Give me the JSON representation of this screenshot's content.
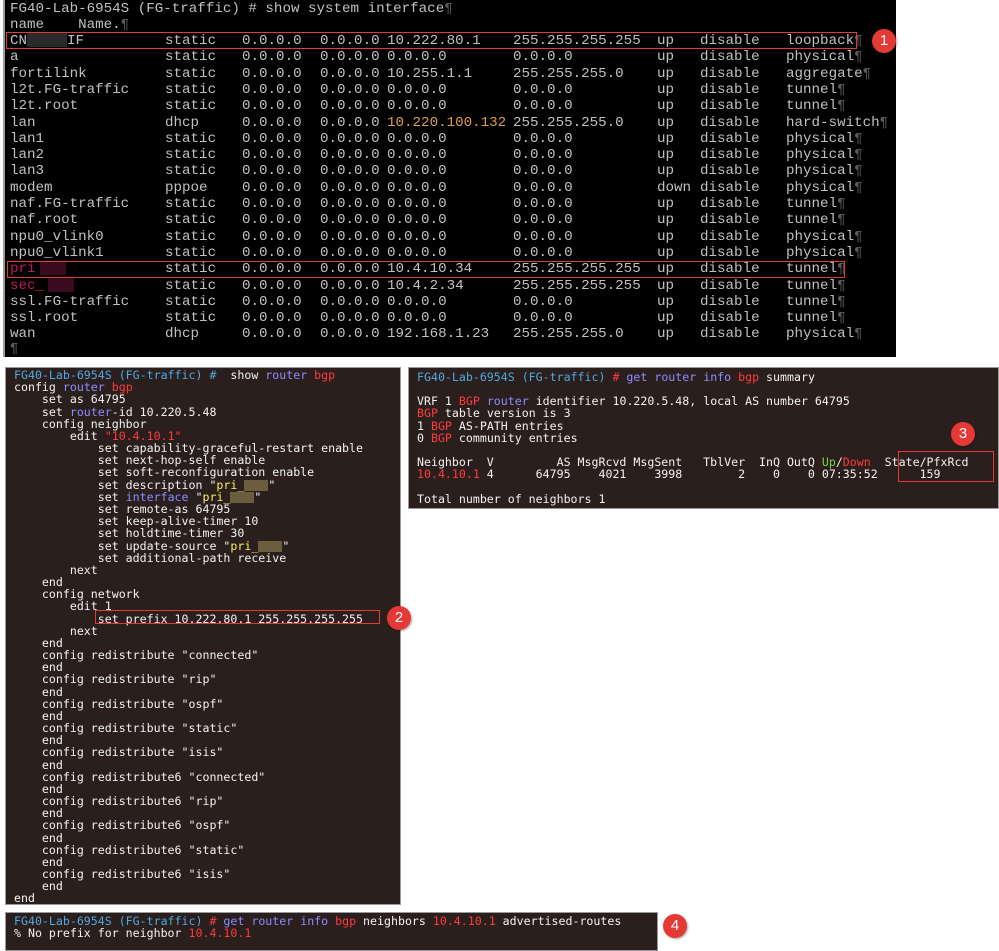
{
  "interfaces_panel": {
    "prompt": "FG40-Lab-6954S (FG-traffic) # show system interface",
    "header": "name    Name.",
    "rows": [
      {
        "name": "CN",
        "name_suffix": "IF",
        "mode": "static",
        "a1": "0.0.0.0",
        "a2": "0.0.0.0",
        "ip": "10.222.80.1",
        "mask": "255.255.255.255",
        "status": "up",
        "s2": "disable",
        "type": "loopback",
        "highlight": true
      },
      {
        "name": "a",
        "mode": "static",
        "a1": "0.0.0.0",
        "a2": "0.0.0.0",
        "ip": "0.0.0.0",
        "mask": "0.0.0.0",
        "status": "up",
        "s2": "disable",
        "type": "physical"
      },
      {
        "name": "fortilink",
        "mode": "static",
        "a1": "0.0.0.0",
        "a2": "0.0.0.0",
        "ip": "10.255.1.1",
        "mask": "255.255.255.0",
        "status": "up",
        "s2": "disable",
        "type": "aggregate"
      },
      {
        "name": "l2t.FG-traffic",
        "mode": "static",
        "a1": "0.0.0.0",
        "a2": "0.0.0.0",
        "ip": "0.0.0.0",
        "mask": "0.0.0.0",
        "status": "up",
        "s2": "disable",
        "type": "tunnel"
      },
      {
        "name": "l2t.root",
        "mode": "static",
        "a1": "0.0.0.0",
        "a2": "0.0.0.0",
        "ip": "0.0.0.0",
        "mask": "0.0.0.0",
        "status": "up",
        "s2": "disable",
        "type": "tunnel"
      },
      {
        "name": "lan",
        "mode": "dhcp",
        "a1": "0.0.0.0",
        "a2": "0.0.0.0",
        "ip": "10.220.100.132",
        "ip_color": "orange",
        "mask": "255.255.255.0",
        "status": "up",
        "s2": "disable",
        "type": "hard-switch"
      },
      {
        "name": "lan1",
        "mode": "static",
        "a1": "0.0.0.0",
        "a2": "0.0.0.0",
        "ip": "0.0.0.0",
        "mask": "0.0.0.0",
        "status": "up",
        "s2": "disable",
        "type": "physical"
      },
      {
        "name": "lan2",
        "mode": "static",
        "a1": "0.0.0.0",
        "a2": "0.0.0.0",
        "ip": "0.0.0.0",
        "mask": "0.0.0.0",
        "status": "up",
        "s2": "disable",
        "type": "physical"
      },
      {
        "name": "lan3",
        "mode": "static",
        "a1": "0.0.0.0",
        "a2": "0.0.0.0",
        "ip": "0.0.0.0",
        "mask": "0.0.0.0",
        "status": "up",
        "s2": "disable",
        "type": "physical"
      },
      {
        "name": "modem",
        "mode": "pppoe",
        "a1": "0.0.0.0",
        "a2": "0.0.0.0",
        "ip": "0.0.0.0",
        "mask": "0.0.0.0",
        "status": "down",
        "s2": "disable",
        "type": "physical"
      },
      {
        "name": "naf.FG-traffic",
        "mode": "static",
        "a1": "0.0.0.0",
        "a2": "0.0.0.0",
        "ip": "0.0.0.0",
        "mask": "0.0.0.0",
        "status": "up",
        "s2": "disable",
        "type": "tunnel"
      },
      {
        "name": "naf.root",
        "mode": "static",
        "a1": "0.0.0.0",
        "a2": "0.0.0.0",
        "ip": "0.0.0.0",
        "mask": "0.0.0.0",
        "status": "up",
        "s2": "disable",
        "type": "tunnel"
      },
      {
        "name": "npu0_vlink0",
        "mode": "static",
        "a1": "0.0.0.0",
        "a2": "0.0.0.0",
        "ip": "0.0.0.0",
        "mask": "0.0.0.0",
        "status": "up",
        "s2": "disable",
        "type": "physical"
      },
      {
        "name": "npu0_vlink1",
        "mode": "static",
        "a1": "0.0.0.0",
        "a2": "0.0.0.0",
        "ip": "0.0.0.0",
        "mask": "0.0.0.0",
        "status": "up",
        "s2": "disable",
        "type": "physical"
      },
      {
        "name": "pri",
        "name_color": "magenta",
        "redacted": true,
        "mode": "static",
        "a1": "0.0.0.0",
        "a2": "0.0.0.0",
        "ip": "10.4.10.34",
        "mask": "255.255.255.255",
        "status": "up",
        "s2": "disable",
        "type": "tunnel",
        "highlight": true
      },
      {
        "name": "sec_",
        "name_color": "magenta",
        "redacted": true,
        "mode": "static",
        "a1": "0.0.0.0",
        "a2": "0.0.0.0",
        "ip": "10.4.2.34",
        "mask": "255.255.255.255",
        "status": "up",
        "s2": "disable",
        "type": "tunnel"
      },
      {
        "name": "ssl.FG-traffic",
        "mode": "static",
        "a1": "0.0.0.0",
        "a2": "0.0.0.0",
        "ip": "0.0.0.0",
        "mask": "0.0.0.0",
        "status": "up",
        "s2": "disable",
        "type": "tunnel"
      },
      {
        "name": "ssl.root",
        "mode": "static",
        "a1": "0.0.0.0",
        "a2": "0.0.0.0",
        "ip": "0.0.0.0",
        "mask": "0.0.0.0",
        "status": "up",
        "s2": "disable",
        "type": "tunnel"
      },
      {
        "name": "wan",
        "mode": "dhcp",
        "a1": "0.0.0.0",
        "a2": "0.0.0.0",
        "ip": "192.168.1.23",
        "mask": "255.255.255.0",
        "status": "up",
        "s2": "disable",
        "type": "physical"
      }
    ],
    "pilcrow": "¶",
    "badge": "1"
  },
  "bgp_config_panel": {
    "prompt_host": "FG40-Lab-6954S (FG-traffic) #",
    "prompt_cmd": [
      {
        "t": "  show ",
        "c": ""
      },
      {
        "t": "router",
        "c": "blue"
      },
      {
        "t": " ",
        "c": ""
      },
      {
        "t": "bgp",
        "c": "red"
      }
    ],
    "lines": [
      [
        {
          "t": "config ",
          "c": ""
        },
        {
          "t": "router",
          "c": "blue"
        },
        {
          "t": " ",
          "c": ""
        },
        {
          "t": "bgp",
          "c": "red"
        }
      ],
      [
        {
          "t": "    set as 64795",
          "c": ""
        }
      ],
      [
        {
          "t": "    set ",
          "c": ""
        },
        {
          "t": "router",
          "c": "blue"
        },
        {
          "t": "-id 10.220.5.48",
          "c": ""
        }
      ],
      [
        {
          "t": "    config neighbor",
          "c": ""
        }
      ],
      [
        {
          "t": "        edit ",
          "c": ""
        },
        {
          "t": "\"10.4.10.1\"",
          "c": "red"
        }
      ],
      [
        {
          "t": "            set capability-graceful-restart enable",
          "c": ""
        }
      ],
      [
        {
          "t": "            set next-hop-self enable",
          "c": ""
        }
      ],
      [
        {
          "t": "            set soft-reconfiguration enable",
          "c": ""
        }
      ],
      [
        {
          "t": "            set description \"",
          "c": ""
        },
        {
          "t": "pri_",
          "c": "yellow"
        },
        {
          "t": "#R",
          "c": ""
        },
        {
          "t": "\"",
          "c": ""
        }
      ],
      [
        {
          "t": "            set ",
          "c": ""
        },
        {
          "t": "interface",
          "c": "blue"
        },
        {
          "t": " \"",
          "c": ""
        },
        {
          "t": "pri_",
          "c": "yellow"
        },
        {
          "t": "#R",
          "c": ""
        },
        {
          "t": "\"",
          "c": ""
        }
      ],
      [
        {
          "t": "            set remote-as 64795",
          "c": ""
        }
      ],
      [
        {
          "t": "            set keep-alive-timer 10",
          "c": ""
        }
      ],
      [
        {
          "t": "            set holdtime-timer 30",
          "c": ""
        }
      ],
      [
        {
          "t": "            set update-source \"",
          "c": ""
        },
        {
          "t": "pri_",
          "c": "yellow"
        },
        {
          "t": "#R",
          "c": ""
        },
        {
          "t": "\"",
          "c": ""
        }
      ],
      [
        {
          "t": "            set additional-path receive",
          "c": ""
        }
      ],
      [
        {
          "t": "        next",
          "c": ""
        }
      ],
      [
        {
          "t": "    end",
          "c": ""
        }
      ],
      [
        {
          "t": "    config network",
          "c": ""
        }
      ],
      [
        {
          "t": "        edit 1",
          "c": ""
        }
      ],
      [
        {
          "t": "            set prefix 10.222.80.1 255.255.255.255",
          "c": ""
        }
      ],
      [
        {
          "t": "        next",
          "c": ""
        }
      ],
      [
        {
          "t": "    end",
          "c": ""
        }
      ],
      [
        {
          "t": "    config redistribute \"connected\"",
          "c": ""
        }
      ],
      [
        {
          "t": "    end",
          "c": ""
        }
      ],
      [
        {
          "t": "    config redistribute \"rip\"",
          "c": ""
        }
      ],
      [
        {
          "t": "    end",
          "c": ""
        }
      ],
      [
        {
          "t": "    config redistribute \"ospf\"",
          "c": ""
        }
      ],
      [
        {
          "t": "    end",
          "c": ""
        }
      ],
      [
        {
          "t": "    config redistribute \"static\"",
          "c": ""
        }
      ],
      [
        {
          "t": "    end",
          "c": ""
        }
      ],
      [
        {
          "t": "    config redistribute \"isis\"",
          "c": ""
        }
      ],
      [
        {
          "t": "    end",
          "c": ""
        }
      ],
      [
        {
          "t": "    config redistribute6 \"connected\"",
          "c": ""
        }
      ],
      [
        {
          "t": "    end",
          "c": ""
        }
      ],
      [
        {
          "t": "    config redistribute6 \"rip\"",
          "c": ""
        }
      ],
      [
        {
          "t": "    end",
          "c": ""
        }
      ],
      [
        {
          "t": "    config redistribute6 \"ospf\"",
          "c": ""
        }
      ],
      [
        {
          "t": "    end",
          "c": ""
        }
      ],
      [
        {
          "t": "    config redistribute6 \"static\"",
          "c": ""
        }
      ],
      [
        {
          "t": "    end",
          "c": ""
        }
      ],
      [
        {
          "t": "    config redistribute6 \"isis\"",
          "c": ""
        }
      ],
      [
        {
          "t": "    end",
          "c": ""
        }
      ],
      [
        {
          "t": "end",
          "c": ""
        }
      ]
    ],
    "highlight_line_index": 19,
    "badge": "2"
  },
  "bgp_summary_panel": {
    "prompt_host": "FG40-Lab-6954S (FG-traffic)",
    "prompt_hash": " #",
    "prompt_cmd": [
      {
        "t": " get ",
        "c": "blue"
      },
      {
        "t": "router",
        "c": "blue"
      },
      {
        "t": " info ",
        "c": "blue"
      },
      {
        "t": "bgp",
        "c": "red"
      },
      {
        "t": " summary",
        "c": ""
      }
    ],
    "lines": [
      [],
      [
        {
          "t": "VRF 1 ",
          "c": ""
        },
        {
          "t": "BGP",
          "c": "red"
        },
        {
          "t": " ",
          "c": ""
        },
        {
          "t": "router",
          "c": "blue"
        },
        {
          "t": " identifier 10.220.5.48, local AS number 64795",
          "c": ""
        }
      ],
      [
        {
          "t": "BGP",
          "c": "red"
        },
        {
          "t": " table version is 3",
          "c": ""
        }
      ],
      [
        {
          "t": "1 ",
          "c": ""
        },
        {
          "t": "BGP",
          "c": "red"
        },
        {
          "t": " AS-PATH entries",
          "c": ""
        }
      ],
      [
        {
          "t": "0 ",
          "c": ""
        },
        {
          "t": "BGP",
          "c": "red"
        },
        {
          "t": " community entries",
          "c": ""
        }
      ],
      [],
      [
        {
          "t": "Neighbor  V         AS MsgRcvd MsgSent   TblVer  InQ OutQ ",
          "c": ""
        },
        {
          "t": "Up",
          "c": "green"
        },
        {
          "t": "/",
          "c": ""
        },
        {
          "t": "Down",
          "c": "red"
        },
        {
          "t": "  State/PfxRcd",
          "c": ""
        }
      ],
      [
        {
          "t": "10.4.10.1",
          "c": "red"
        },
        {
          "t": " 4      64795    4021    3998        2    0    0 07:35:52      159",
          "c": ""
        }
      ],
      [],
      [
        {
          "t": "Total number of neighbors 1",
          "c": ""
        }
      ]
    ],
    "neighbor": {
      "address": "10.4.10.1",
      "version": "4",
      "as": "64795",
      "msg_rcvd": "4021",
      "msg_sent": "3998",
      "tbl_ver": "2",
      "inq": "0",
      "outq": "0",
      "up_down": "07:35:52",
      "state_pfxrcd": "159"
    },
    "badge": "3"
  },
  "advertised_routes_panel": {
    "prompt_host": "FG40-Lab-6954S (FG-traffic)",
    "prompt_hash": " #",
    "prompt_cmd": [
      {
        "t": " get ",
        "c": "blue"
      },
      {
        "t": "router",
        "c": "blue"
      },
      {
        "t": " info ",
        "c": "blue"
      },
      {
        "t": "bgp",
        "c": "red"
      },
      {
        "t": " neighbors ",
        "c": ""
      },
      {
        "t": "10.4.10.1",
        "c": "red"
      },
      {
        "t": " advertised-routes",
        "c": ""
      }
    ],
    "lines": [
      [
        {
          "t": "% No prefix for neighbor ",
          "c": ""
        },
        {
          "t": "10.4.10.1",
          "c": "red"
        }
      ]
    ],
    "badge": "4"
  },
  "colors": {
    "terminal1_bg": "#000000",
    "terminal2_bg": "#2b1f1e",
    "highlight_box": "#e53935",
    "badge": "#e53935",
    "cyan": "#4fa9e0",
    "blue": "#8c8cff",
    "red": "#ff3b3b",
    "yellow": "#f5f05a",
    "green": "#7ad13a",
    "orange": "#e19a48",
    "magenta": "#c2185b"
  }
}
